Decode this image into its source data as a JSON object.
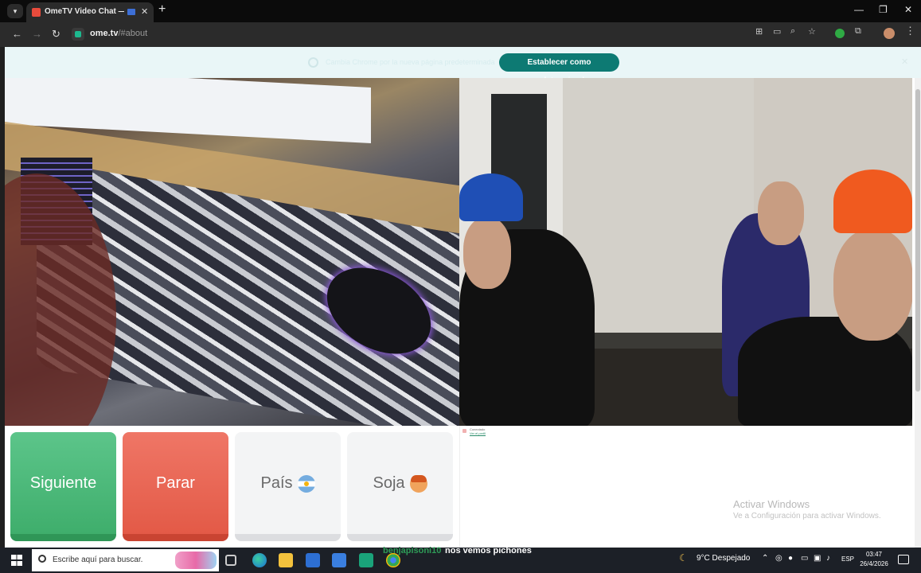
{
  "browser": {
    "tab_title": "OmeTV Video Chat — Alte",
    "url_host": "ome.tv",
    "url_path": "/#about",
    "new_tab_symbol": "+",
    "tab_close_symbol": "✕"
  },
  "banner": {
    "text": "Cambia Chrome por la nueva página predeterminada",
    "button_label": "Establecer como predeterminado",
    "close_symbol": "✕"
  },
  "controls": {
    "next_label": "Siguiente",
    "stop_label": "Parar",
    "country_label": "País",
    "gender_label": "Soja"
  },
  "chat": {
    "message": "Conectado",
    "link": "Ver el perfil",
    "windows_watermark_title": "Activar Windows",
    "windows_watermark_sub": "Ve a Configuración para activar Windows."
  },
  "taskbar": {
    "search_placeholder": "Escribe aquí para buscar.",
    "overlay_username": "benjapisoni10",
    "overlay_message": "nos vemos pichones",
    "weather": "9°C  Despejado",
    "language": "ESP",
    "time": "03:47",
    "date": "26/4/2026"
  },
  "colors": {
    "accent": "#0d7a73",
    "next_green": "#4cbb7a",
    "stop_red": "#e8624f"
  },
  "icons": [
    "search-icon",
    "back-arrow-icon",
    "forward-arrow-icon",
    "reload-icon",
    "translate-icon",
    "zoom-icon",
    "star-icon",
    "extensions-icon",
    "kebab-menu-icon",
    "windows-start-icon"
  ]
}
